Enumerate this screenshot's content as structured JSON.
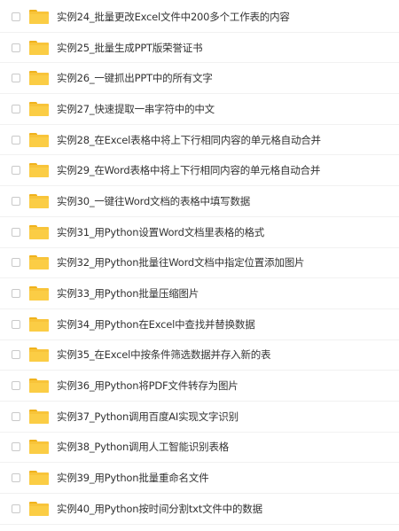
{
  "files": [
    {
      "name": "实例24_批量更改Excel文件中200多个工作表的内容",
      "icon": "folder-icon"
    },
    {
      "name": "实例25_批量生成PPT版荣誉证书",
      "icon": "folder-icon"
    },
    {
      "name": "实例26_一键抓出PPT中的所有文字",
      "icon": "folder-icon"
    },
    {
      "name": "实例27_快速提取一串字符中的中文",
      "icon": "folder-icon"
    },
    {
      "name": "实例28_在Excel表格中将上下行相同内容的单元格自动合并",
      "icon": "folder-icon"
    },
    {
      "name": "实例29_在Word表格中将上下行相同内容的单元格自动合并",
      "icon": "folder-icon"
    },
    {
      "name": "实例30_一键往Word文档的表格中填写数据",
      "icon": "folder-icon"
    },
    {
      "name": "实例31_用Python设置Word文档里表格的格式",
      "icon": "folder-icon"
    },
    {
      "name": "实例32_用Python批量往Word文档中指定位置添加图片",
      "icon": "folder-icon"
    },
    {
      "name": "实例33_用Python批量压缩图片",
      "icon": "folder-icon"
    },
    {
      "name": "实例34_用Python在Excel中查找并替换数据",
      "icon": "folder-icon"
    },
    {
      "name": "实例35_在Excel中按条件筛选数据并存入新的表",
      "icon": "folder-icon"
    },
    {
      "name": "实例36_用Python将PDF文件转存为图片",
      "icon": "folder-icon"
    },
    {
      "name": "实例37_Python调用百度AI实现文字识别",
      "icon": "folder-icon"
    },
    {
      "name": "实例38_Python调用人工智能识别表格",
      "icon": "folder-icon"
    },
    {
      "name": "实例39_用Python批量重命名文件",
      "icon": "folder-icon"
    },
    {
      "name": "实例40_用Python按时间分割txt文件中的数据",
      "icon": "folder-icon"
    }
  ],
  "colors": {
    "folder": "#f8c43a",
    "folder_tab": "#f0b21c",
    "text": "#333333",
    "checkbox_border": "#c9c9c9"
  }
}
